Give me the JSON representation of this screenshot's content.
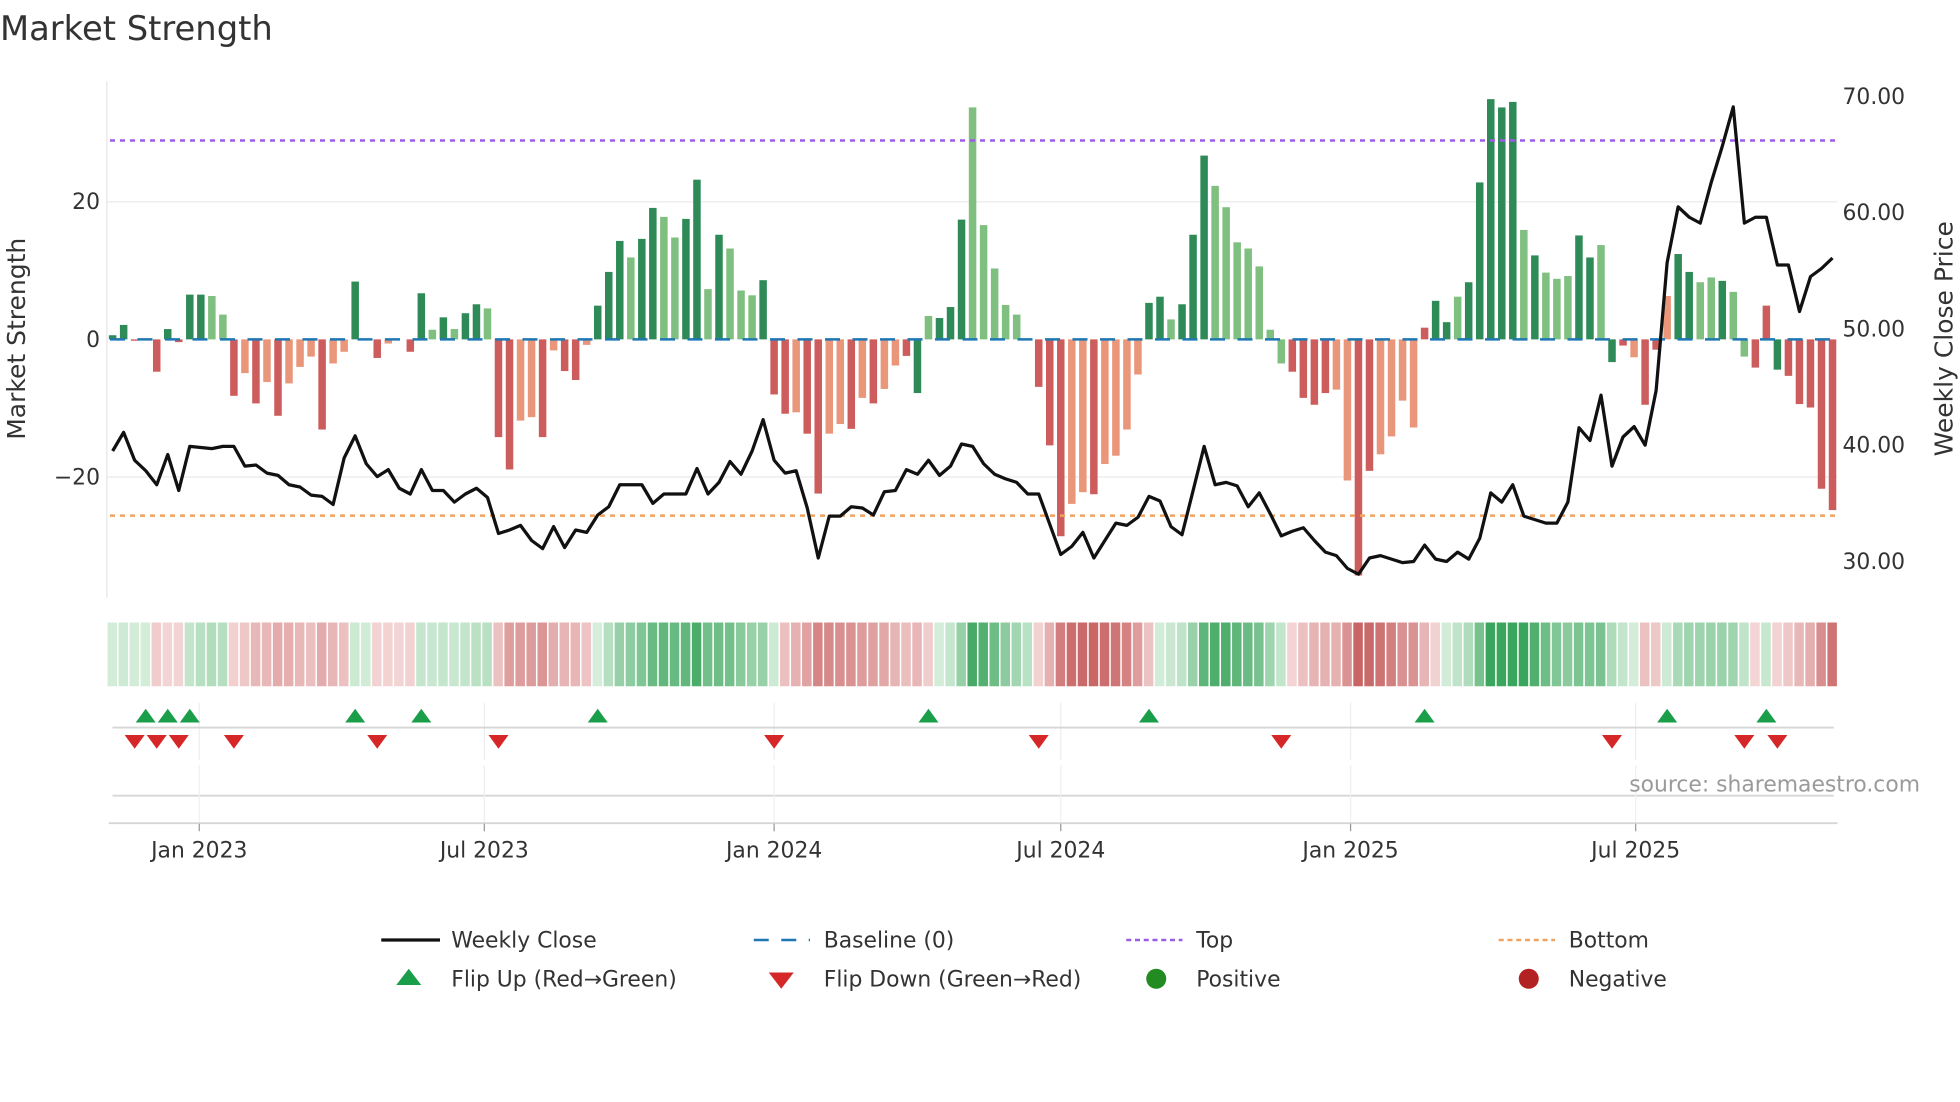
{
  "chart_data": {
    "type": "bar",
    "title": "Market Strength",
    "ylabel": "Market Strength",
    "y2label": "Weekly Close Price",
    "ylim": [
      -37.5,
      37.5
    ],
    "y2lim": [
      26.9,
      71.3
    ],
    "yticks": [
      {
        "value": 20,
        "label": "20"
      },
      {
        "value": 0,
        "label": "0"
      },
      {
        "value": -20,
        "label": "−20"
      }
    ],
    "y2ticks": [
      {
        "value": 70,
        "label": "70.00"
      },
      {
        "value": 60,
        "label": "60.00"
      },
      {
        "value": 50,
        "label": "50.00"
      },
      {
        "value": 40,
        "label": "40.00"
      },
      {
        "value": 30,
        "label": "30.00"
      }
    ],
    "xticks": [
      {
        "date": "2023-01-01",
        "label": "Jan 2023"
      },
      {
        "date": "2023-07-01",
        "label": "Jul 2023"
      },
      {
        "date": "2024-01-01",
        "label": "Jan 2024"
      },
      {
        "date": "2024-07-01",
        "label": "Jul 2024"
      },
      {
        "date": "2025-01-01",
        "label": "Jan 2025"
      },
      {
        "date": "2025-07-01",
        "label": "Jul 2025"
      }
    ],
    "start_date": "2022-11-07",
    "interval": "weekly",
    "top_threshold": 28.9,
    "bottom_threshold": -25.6,
    "grid": true,
    "legend_placement": "bottom-center",
    "strength": [
      0.6,
      2.1,
      -0.2,
      0,
      -4.7,
      1.5,
      -0.4,
      6.5,
      6.5,
      6.3,
      3.6,
      -8.2,
      -4.9,
      -9.3,
      -6.2,
      -11.1,
      -6.4,
      -4.0,
      -2.5,
      -13.1,
      -3.5,
      -1.8,
      8.4,
      0,
      -2.7,
      -0.6,
      0,
      -1.8,
      6.7,
      1.4,
      3.2,
      1.5,
      3.8,
      5.1,
      4.5,
      -14.2,
      -18.9,
      -11.8,
      -11.3,
      -14.2,
      -1.6,
      -4.6,
      -5.9,
      -0.8,
      4.9,
      9.8,
      14.3,
      11.9,
      14.6,
      19.1,
      17.8,
      14.8,
      17.5,
      23.2,
      7.3,
      15.2,
      13.2,
      7.1,
      6.4,
      8.6,
      -8.0,
      -10.8,
      -10.6,
      -13.7,
      -22.4,
      -13.7,
      -12.3,
      -13.0,
      -8.5,
      -9.3,
      -7.2,
      -3.8,
      -2.4,
      -7.8,
      3.4,
      3.1,
      4.7,
      17.4,
      33.7,
      16.6,
      10.3,
      5.0,
      3.6,
      0,
      -6.9,
      -15.4,
      -28.6,
      -23.9,
      -22.2,
      -22.5,
      -18.1,
      -16.9,
      -13.1,
      -5.1,
      5.3,
      6.2,
      2.9,
      5.1,
      15.2,
      26.7,
      22.3,
      19.2,
      14.1,
      13.2,
      10.6,
      1.4,
      -3.5,
      -4.7,
      -8.5,
      -9.5,
      -7.8,
      -7.3,
      -20.5,
      -34.3,
      -19.1,
      -16.7,
      -14.1,
      -8.9,
      -12.8,
      1.7,
      5.6,
      2.5,
      6.2,
      8.3,
      22.8,
      34.9,
      33.7,
      34.5,
      15.9,
      12.2,
      9.7,
      8.8,
      9.2,
      15.1,
      11.9,
      13.7,
      -3.3,
      -0.9,
      -2.6,
      -9.5,
      -1.5,
      6.3,
      12.4,
      9.8,
      8.3,
      9.0,
      8.5,
      6.9,
      -2.5,
      -4.1,
      4.9,
      -4.4,
      -5.3,
      -9.4,
      -9.9,
      -21.7,
      -24.8
    ],
    "bar_shade": "GGR0RGRGGggRrRrRrrrRrrG0Rr0RGgGgGGgRRrrRrRRrGGGgGGggGGgGgggGRRrRRrrRrRrrRGgGGGggggg0RRRrrRrrrrGGgGGGgggggggRRRRrrRRrrrrRGGgGGGGGgGgggGGgGRrRRrGGggGggRRGRRRRRR",
    "close": [
      39.5,
      41.1,
      38.7,
      37.8,
      36.6,
      39.2,
      36.1,
      39.9,
      39.8,
      39.7,
      39.9,
      39.9,
      38.2,
      38.3,
      37.6,
      37.4,
      36.6,
      36.4,
      35.7,
      35.6,
      34.9,
      38.9,
      40.8,
      38.4,
      37.3,
      37.9,
      36.3,
      35.8,
      37.9,
      36.1,
      36.1,
      35.1,
      35.8,
      36.3,
      35.5,
      32.4,
      32.7,
      33.1,
      31.8,
      31.1,
      33.0,
      31.2,
      32.7,
      32.5,
      34.0,
      34.7,
      36.6,
      36.6,
      36.6,
      35.0,
      35.8,
      35.8,
      35.8,
      38.0,
      35.8,
      36.8,
      38.6,
      37.5,
      39.5,
      42.2,
      38.7,
      37.6,
      37.8,
      34.6,
      30.3,
      33.9,
      33.9,
      34.7,
      34.6,
      34.0,
      36.0,
      36.1,
      37.9,
      37.5,
      38.7,
      37.4,
      38.2,
      40.1,
      39.9,
      38.4,
      37.5,
      37.1,
      36.8,
      35.8,
      35.8,
      33.2,
      30.6,
      31.3,
      32.5,
      30.3,
      31.8,
      33.3,
      33.1,
      33.8,
      35.6,
      35.2,
      33.0,
      32.3,
      36.1,
      39.9,
      36.6,
      36.8,
      36.5,
      34.7,
      35.9,
      34.1,
      32.2,
      32.6,
      32.9,
      31.8,
      30.8,
      30.5,
      29.4,
      28.9,
      30.3,
      30.5,
      30.2,
      29.9,
      30.0,
      31.4,
      30.2,
      30.0,
      30.8,
      30.2,
      32.0,
      35.9,
      35.1,
      36.6,
      33.9,
      33.6,
      33.3,
      33.3,
      35.1,
      41.5,
      40.4,
      44.3,
      38.2,
      40.7,
      41.6,
      40.0,
      44.7,
      55.7,
      60.5,
      59.6,
      59.1,
      62.6,
      65.7,
      69.1,
      59.1,
      59.6,
      59.6,
      55.5,
      55.5,
      51.5,
      54.5,
      55.2,
      56.1
    ],
    "flip_up_weeks": [
      3,
      5,
      7,
      22,
      28,
      44,
      74,
      94,
      119,
      141,
      150
    ],
    "flip_down_weeks": [
      2,
      4,
      6,
      11,
      24,
      35,
      60,
      84,
      106,
      136,
      148,
      151
    ],
    "legend": [
      {
        "key": "weekly_close",
        "label": "Weekly Close"
      },
      {
        "key": "baseline",
        "label": "Baseline (0)"
      },
      {
        "key": "top",
        "label": "Top"
      },
      {
        "key": "bottom",
        "label": "Bottom"
      },
      {
        "key": "flip_up",
        "label": "Flip Up (Red→Green)"
      },
      {
        "key": "flip_down",
        "label": "Flip Down (Green→Red)"
      },
      {
        "key": "positive",
        "label": "Positive"
      },
      {
        "key": "negative",
        "label": "Negative"
      }
    ],
    "source": "source: sharemaestro.com"
  },
  "colors": {
    "dark_green": "#2e8b57",
    "light_green": "#7fbf7f",
    "dark_red": "#cd5c5c",
    "light_red": "#e9967a",
    "top": "#9b5de5",
    "bottom": "#f0a35e",
    "baseline": "#1f77b4",
    "flip_up": "#1a9e4a",
    "flip_down": "#d62728",
    "positive": "#228b22",
    "negative": "#b22222"
  }
}
